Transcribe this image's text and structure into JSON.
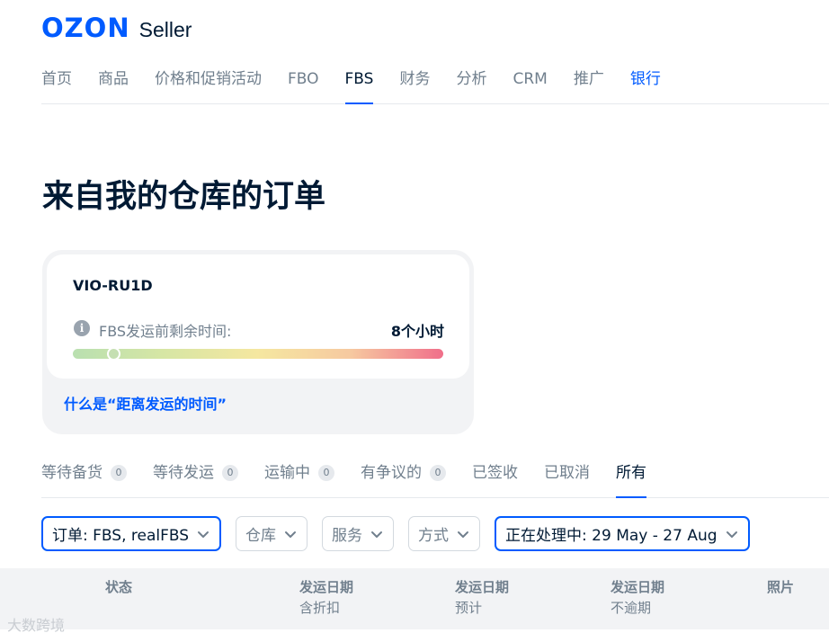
{
  "logo": {
    "brand": "OZON",
    "product": "Seller"
  },
  "topnav": [
    {
      "label": "首页"
    },
    {
      "label": "商品"
    },
    {
      "label": "价格和促销活动"
    },
    {
      "label": "FBO"
    },
    {
      "label": "FBS"
    },
    {
      "label": "财务"
    },
    {
      "label": "分析"
    },
    {
      "label": "CRM"
    },
    {
      "label": "推广"
    },
    {
      "label": "银行"
    }
  ],
  "page_title": "来自我的仓库的订单",
  "card": {
    "code": "VIO-RU1D",
    "info_label": "FBS发运前剩余时间:",
    "info_value": "8个小时",
    "progress_fraction": 0.11,
    "link_text": "什么是“距离发运的时间”"
  },
  "status_tabs": [
    {
      "label": "等待备货",
      "count": "0"
    },
    {
      "label": "等待发运",
      "count": "0"
    },
    {
      "label": "运输中",
      "count": "0"
    },
    {
      "label": "有争议的",
      "count": "0"
    },
    {
      "label": "已签收"
    },
    {
      "label": "已取消"
    },
    {
      "label": "所有"
    }
  ],
  "filters": [
    {
      "label": "订单: FBS, realFBS",
      "selected": true
    },
    {
      "label": "仓库",
      "selected": false
    },
    {
      "label": "服务",
      "selected": false
    },
    {
      "label": "方式",
      "selected": false
    },
    {
      "label": "正在处理中: 29 May - 27 Aug",
      "selected": true
    }
  ],
  "table_header": {
    "status": "状态",
    "col1_main": "发运日期",
    "col1_sub": "含折扣",
    "col2_main": "发运日期",
    "col2_sub": "预计",
    "col3_main": "发运日期",
    "col3_sub": "不逾期",
    "photo": "照片"
  },
  "watermark": "大数跨境",
  "colors": {
    "accent": "#005bff",
    "text": "#001a34",
    "muted": "#707f8d"
  }
}
